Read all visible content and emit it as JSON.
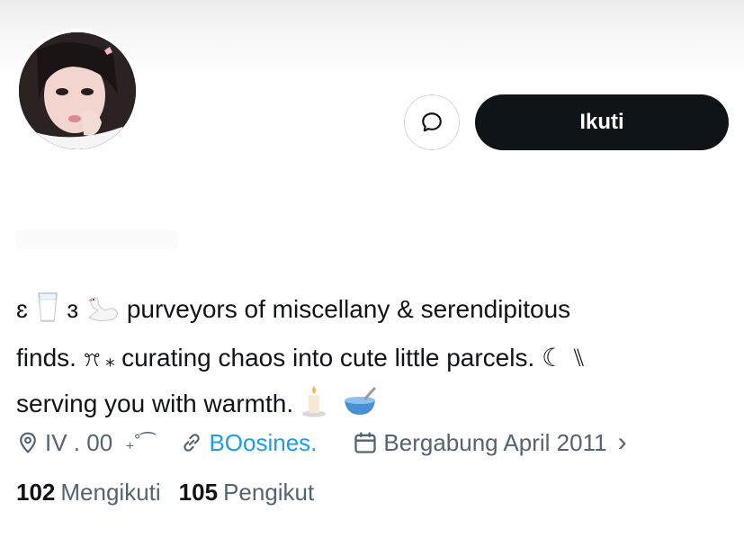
{
  "profile": {
    "follow_label": "Ikuti",
    "bio": {
      "line1_a": "ɛ",
      "line1_b": "ɜ",
      "line1_text": "purveyors of miscellany & serendipitous",
      "line2_a": "finds.",
      "line2_b": "ꔫ ⁎",
      "line2_text": "curating chaos into cute little parcels.",
      "line2_c": "☾ ⑊",
      "line3_text": "serving you with warmth."
    },
    "meta": {
      "location": "IV . 00",
      "location_decor": "₊˚⁀",
      "website": "BOosines.",
      "joined": "Bergabung April 2011",
      "joined_chevron": "›"
    },
    "stats": {
      "following_count": "102",
      "following_label": "Mengikuti",
      "followers_count": "105",
      "followers_label": "Pengikut"
    }
  },
  "icons": {
    "message": "message-bubble-icon",
    "location": "location-pin-icon",
    "link": "link-icon",
    "calendar": "calendar-icon",
    "milk": "milk-glass-icon",
    "swan": "swan-icon",
    "candle": "candle-icon",
    "bowl": "bowl-icon"
  },
  "colors": {
    "text_primary": "#0f1419",
    "text_secondary": "#536471",
    "link": "#1d9bf0",
    "follow_bg": "#0f1419",
    "follow_text": "#ffffff",
    "border": "#cfd9de"
  }
}
